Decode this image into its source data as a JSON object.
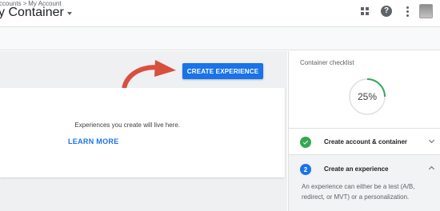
{
  "header": {
    "breadcrumb": [
      "ccounts",
      "My Account"
    ],
    "breadcrumb_separator": ">",
    "title": "y Container",
    "icons": [
      "apps-grid-icon",
      "help-icon",
      "more-vert-icon"
    ],
    "help_glyph": "?"
  },
  "main": {
    "create_button_label": "CREATE EXPERIENCE",
    "empty_text": "Experiences you create will live here.",
    "learn_more_label": "LEARN MORE"
  },
  "checklist": {
    "title": "Container checklist",
    "progress_value": 0.25,
    "progress_text": "25%",
    "steps": [
      {
        "number": "",
        "label": "Create account & container",
        "status": "complete",
        "icon": "check-icon"
      },
      {
        "number": "2",
        "label": "Create an experience",
        "status": "current",
        "expanded": true,
        "description": "An experience can either be a test (A/B, redirect, or MVT) or a personalization."
      }
    ]
  },
  "colors": {
    "primary": "#1a73e8",
    "success": "#34a853",
    "annotation_arrow": "#d94f3d",
    "progress_ring": "#34a853"
  }
}
